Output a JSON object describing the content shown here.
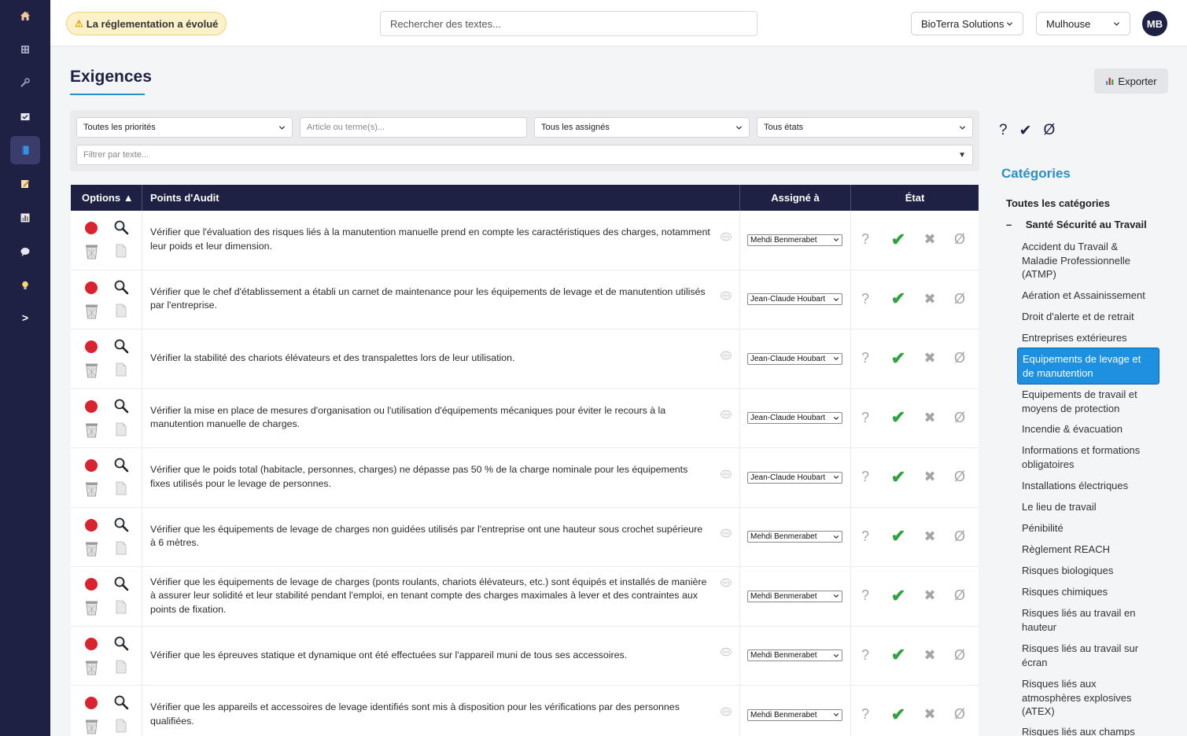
{
  "sidebar": {
    "expand_label": ">"
  },
  "topbar": {
    "alert_label": "La réglementation a évolué",
    "search_placeholder": "Rechercher des textes...",
    "company": "BioTerra Solutions",
    "site": "Mulhouse",
    "user_initials": "MB"
  },
  "page": {
    "title": "Exigences",
    "export_label": "Exporter"
  },
  "filters": {
    "priority": "Toutes les priorités",
    "article_placeholder": "Article ou terme(s)...",
    "assignee": "Tous les assignés",
    "state": "Tous états",
    "text_placeholder": "Filtrer par texte..."
  },
  "table": {
    "headers": {
      "options": "Options ▲",
      "points": "Points d'Audit",
      "assigned": "Assigné à",
      "state": "État"
    },
    "state_symbols": {
      "unknown": "?",
      "ok": "✔",
      "ko": "✖",
      "na": "Ø"
    },
    "rows": [
      {
        "text": "Vérifier que l'évaluation des risques liés à la manutention manuelle prend en compte les caractéristiques des charges, notamment leur poids et leur dimension.",
        "assignee": "Mehdi Benmerabet"
      },
      {
        "text": "Vérifier que le chef d'établissement a établi un carnet de maintenance pour les équipements de levage et de manutention utilisés par l'entreprise.",
        "assignee": "Jean-Claude Houbart"
      },
      {
        "text": "Vérifier la stabilité des chariots élévateurs et des transpalettes lors de leur utilisation.",
        "assignee": "Jean-Claude Houbart"
      },
      {
        "text": "Vérifier la mise en place de mesures d'organisation ou l'utilisation d'équipements mécaniques pour éviter le recours à la manutention manuelle de charges.",
        "assignee": "Jean-Claude Houbart"
      },
      {
        "text": "Vérifier que le poids total (habitacle, personnes, charges) ne dépasse pas 50 % de la charge nominale pour les équipements fixes utilisés pour le levage de personnes.",
        "assignee": "Jean-Claude Houbart"
      },
      {
        "text": "Vérifier que les équipements de levage de charges non guidées utilisés par l'entreprise ont une hauteur sous crochet supérieure à 6 mètres.",
        "assignee": "Mehdi Benmerabet"
      },
      {
        "text": "Vérifier que les équipements de levage de charges (ponts roulants, chariots élévateurs, etc.) sont équipés et installés de manière à assurer leur solidité et leur stabilité pendant l'emploi, en tenant compte des charges maximales à lever et des contraintes aux points de fixation.",
        "assignee": "Mehdi Benmerabet"
      },
      {
        "text": "Vérifier que les épreuves statique et dynamique ont été effectuées sur l'appareil muni de tous ses accessoires.",
        "assignee": "Mehdi Benmerabet"
      },
      {
        "text": "Vérifier que les appareils et accessoires de levage identifiés sont mis à disposition pour les vérifications par des personnes qualifiées.",
        "assignee": "Mehdi Benmerabet"
      }
    ]
  },
  "right_panel": {
    "state_icons": [
      "?",
      "✔",
      "Ø"
    ],
    "title": "Catégories",
    "all_label": "Toutes les catégories",
    "group_toggle": "–",
    "group_label": "Santé Sécurité au Travail",
    "categories": [
      "Accident du Travail & Maladie Professionnelle (ATMP)",
      "Aération et Assainissement",
      "Droit d'alerte et de retrait",
      "Entreprises extérieures",
      "Equipements de levage et de manutention",
      "Equipements de travail et moyens de protection",
      "Incendie & évacuation",
      "Informations et formations obligatoires",
      "Installations électriques",
      "Le lieu de travail",
      "Pénibilité",
      "Règlement REACH",
      "Risques biologiques",
      "Risques chimiques",
      "Risques liés au travail en hauteur",
      "Risques liés au travail sur écran",
      "Risques liés aux atmosphères explosives (ATEX)",
      "Risques liés aux champs"
    ]
  },
  "colors": {
    "sidebar_bg": "#1e2044",
    "accent": "#2a8fc7",
    "active_category": "#1f8fe0",
    "priority_red": "#d9242f",
    "ok_green": "#2fa33c"
  }
}
